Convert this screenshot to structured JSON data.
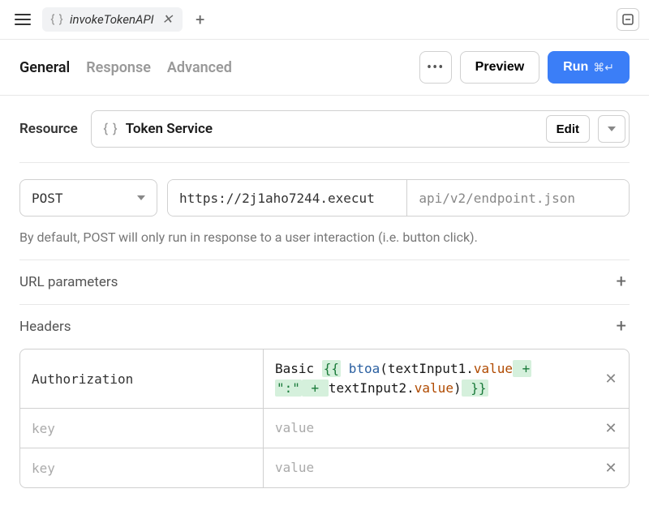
{
  "topbar": {
    "tab_name": "invokeTokenAPI"
  },
  "nav": {
    "general": "General",
    "response": "Response",
    "advanced": "Advanced"
  },
  "actions": {
    "preview": "Preview",
    "run": "Run",
    "run_shortcut": "⌘↵"
  },
  "resource": {
    "label": "Resource",
    "name": "Token Service",
    "edit": "Edit"
  },
  "request": {
    "method": "POST",
    "url": "https://2j1aho7244.execut",
    "url_suffix": "api/v2/endpoint.json",
    "hint": "By default, POST will only run in response to a user interaction (i.e. button click)."
  },
  "sections": {
    "url_params": "URL parameters",
    "headers": "Headers"
  },
  "headers": {
    "row0": {
      "key": "Authorization",
      "prefix": "Basic ",
      "open": "{{",
      "fn": "btoa",
      "lp": "(",
      "var1": "textInput1",
      "dot1": ".",
      "prop1": "value",
      "plus1": " + ",
      "str": "\":\"",
      "plus2": " + ",
      "var2": "textInput2",
      "dot2": ".",
      "prop2": "value",
      "rp": ")",
      "close": " }}"
    },
    "placeholder_key": "key",
    "placeholder_value": "value"
  }
}
